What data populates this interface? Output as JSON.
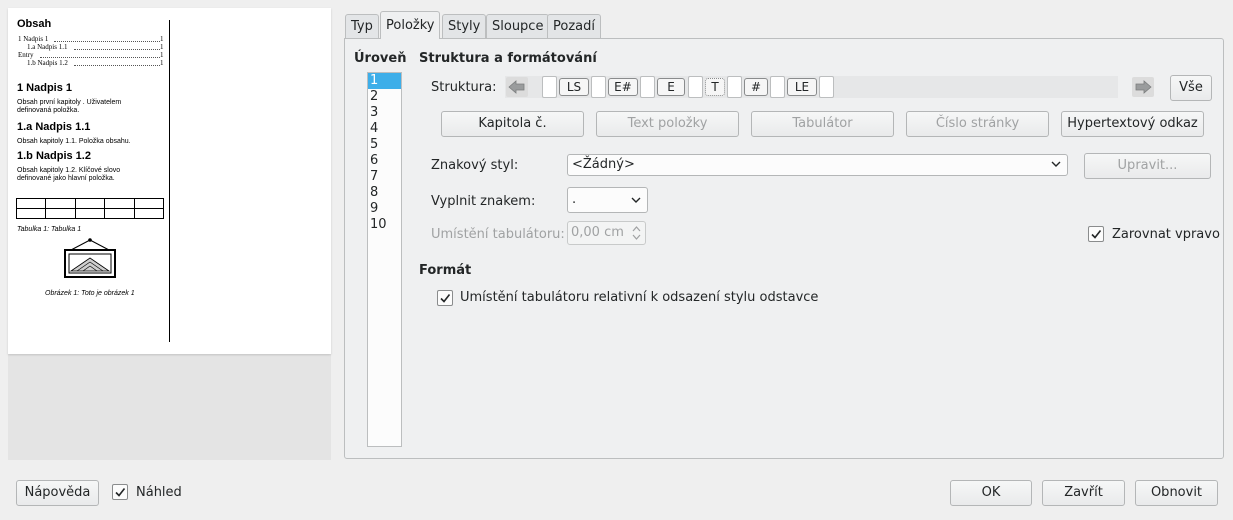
{
  "preview": {
    "toc_title": "Obsah",
    "toc_lines": [
      {
        "text": "1 Nadpis 1",
        "page": "1"
      },
      {
        "text": "1.a Nadpis 1.1",
        "page": "1"
      },
      {
        "text": "Entry",
        "page": "1"
      },
      {
        "text": "1.b Nadpis 1.2",
        "page": "1"
      }
    ],
    "heading1": "1 Nadpis 1",
    "body1": [
      "Obsah první kapitoly . Uživatelem",
      "definovaná položka."
    ],
    "heading11": "1.a   Nadpis 1.1",
    "body11": "Obsah kapitoly 1.1. Položka obsahu.",
    "heading12": "1.b   Nadpis 1.2",
    "body12": [
      "Obsah kapitoly 1.2. Klíčové slovo",
      "definované jako hlavní položka."
    ],
    "table_caption": "Tabulka 1: Tabulka 1",
    "image_caption": "Obrázek 1: Toto je obrázek 1"
  },
  "tabs": [
    "Typ",
    "Položky",
    "Styly",
    "Sloupce",
    "Pozadí"
  ],
  "active_tab": "Položky",
  "level": {
    "header": "Úroveň",
    "items": [
      "1",
      "2",
      "3",
      "4",
      "5",
      "6",
      "7",
      "8",
      "9",
      "10"
    ],
    "selected": "1"
  },
  "section_structure": "Struktura a formátování",
  "structure": {
    "label": "Struktura:",
    "tokens": [
      "LS",
      "E#",
      "E",
      "T",
      "#",
      "LE"
    ],
    "all_button": "Vše"
  },
  "insert_buttons": {
    "chapter": "Kapitola č.",
    "entry_text": "Text položky",
    "tab_stop": "Tabulátor",
    "page_number": "Číslo stránky",
    "hyperlink": "Hypertextový odkaz"
  },
  "char_style": {
    "label": "Znakový styl:",
    "value": "<Žádný>",
    "edit_button": "Upravit..."
  },
  "fill_char": {
    "label": "Vyplnit znakem:",
    "value": "."
  },
  "tab_position": {
    "label": "Umístění tabulátoru:",
    "value": "0,00 cm"
  },
  "align_right": {
    "label": "Zarovnat vpravo",
    "checked": true
  },
  "section_format": "Formát",
  "tab_relative": {
    "label": "Umístění tabulátoru relativní k odsazení stylu odstavce",
    "checked": true
  },
  "footer": {
    "help": "Nápověda",
    "preview_label": "Náhled",
    "preview_checked": true,
    "ok": "OK",
    "close": "Zavřít",
    "reset": "Obnovit"
  },
  "colors": {
    "selection": "#3daee9",
    "window_bg": "#efefef"
  }
}
